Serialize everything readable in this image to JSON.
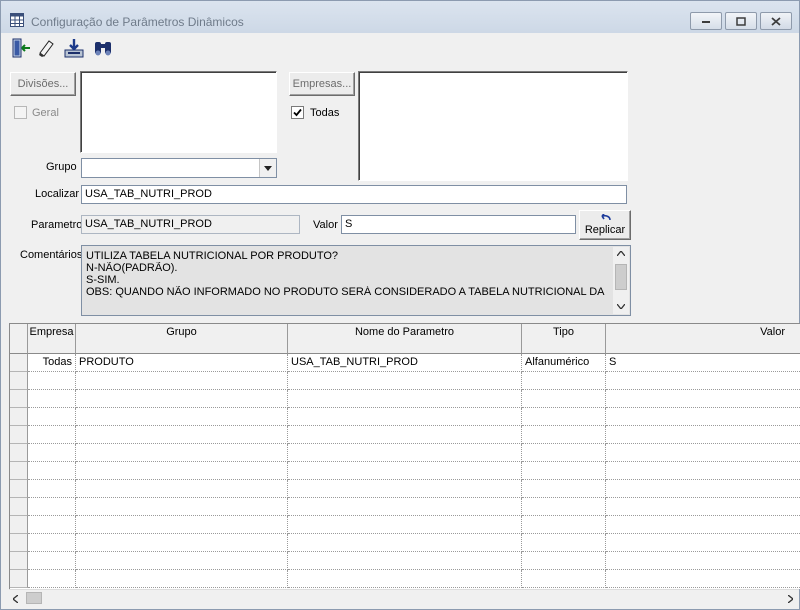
{
  "window": {
    "title": "Configuração de Parâmetros Dinâmicos"
  },
  "toolbar": {
    "icons": [
      "exit-door-icon",
      "eraser-icon",
      "save-download-icon",
      "binoculars-icon"
    ]
  },
  "filters": {
    "divisoes_button": "Divisões...",
    "geral_label": "Geral",
    "empresas_button": "Empresas...",
    "todas_label": "Todas",
    "todas_checked": true,
    "grupo_label": "Grupo",
    "grupo_value": ""
  },
  "form": {
    "localizar_label": "Localizar",
    "localizar_value": "USA_TAB_NUTRI_PROD",
    "parametro_label": "Parametro",
    "parametro_value": "USA_TAB_NUTRI_PROD",
    "valor_label": "Valor",
    "valor_value": "S",
    "replicar_button": "Replicar",
    "comentarios_label": "Comentários",
    "comentarios_lines": [
      "UTILIZA TABELA NUTRICIONAL POR PRODUTO?",
      "N-NÃO(PADRÃO).",
      "S-SIM.",
      "OBS: QUANDO NÃO INFORMADO NO PRODUTO SERÁ CONSIDERADO A TABELA NUTRICIONAL DA"
    ]
  },
  "grid": {
    "columns": [
      "Empresa",
      "Grupo",
      "Nome do Parametro",
      "Tipo",
      "Valor"
    ],
    "rows": [
      {
        "empresa": "Todas",
        "grupo": "PRODUTO",
        "nome": "USA_TAB_NUTRI_PROD",
        "tipo": "Alfanumérico",
        "valor": "S"
      }
    ]
  },
  "colors": {
    "title_text": "#6f7b8a",
    "field_border": "#7f8fa4",
    "window_bg": "#f0f0f0"
  }
}
